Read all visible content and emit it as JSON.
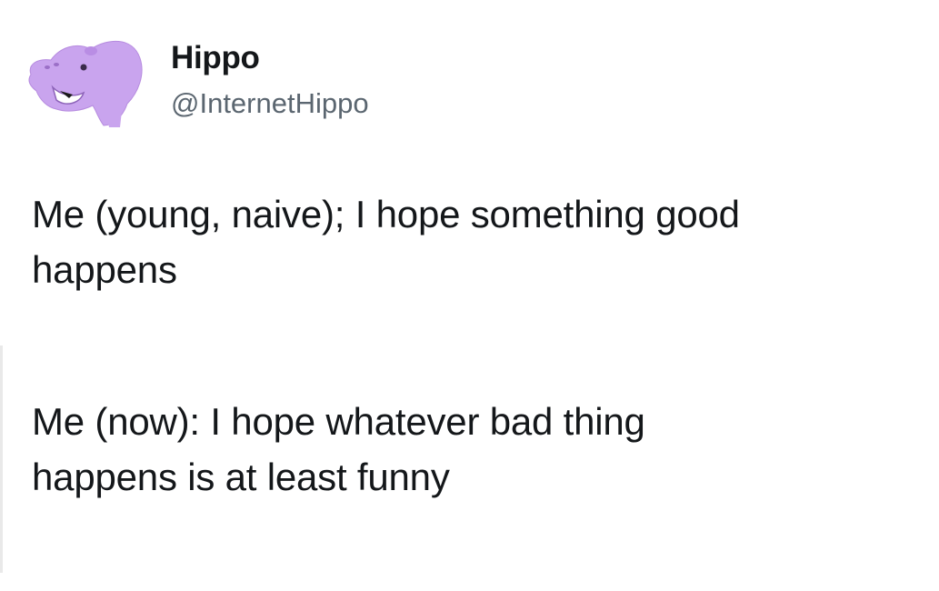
{
  "tweet": {
    "author": {
      "display_name": "Hippo",
      "handle": "@InternetHippo",
      "avatar_icon": "hippo-avatar-icon",
      "avatar_color": "#c9a4ee"
    },
    "paragraphs": [
      "Me (young, naive); I hope something good\nhappens",
      "Me (now): I hope whatever bad thing\nhappens is at least funny"
    ]
  }
}
